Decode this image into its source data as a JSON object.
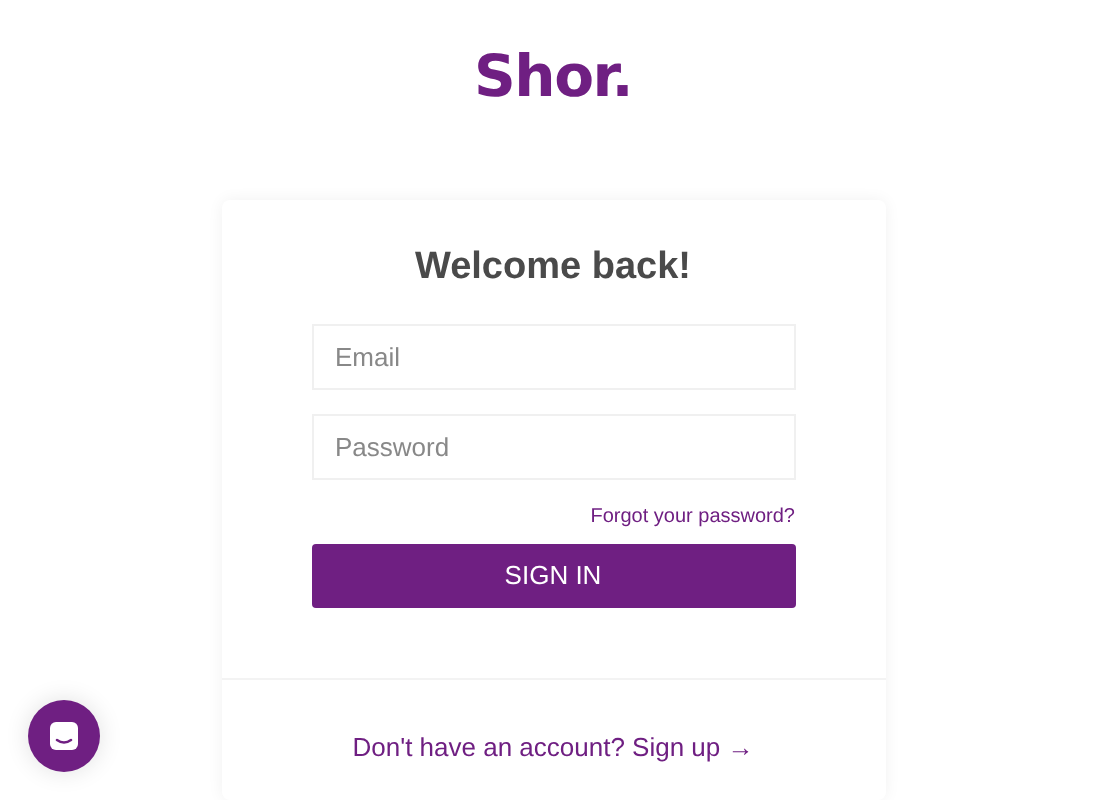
{
  "logo": "Shor.",
  "heading": "Welcome back!",
  "fields": [
    {
      "placeholder": "Email"
    },
    {
      "placeholder": "Password"
    }
  ],
  "forgot_link": "Forgot your password?",
  "submit_button": "SIGN IN",
  "signup_link": "Don't have an account? Sign up →"
}
